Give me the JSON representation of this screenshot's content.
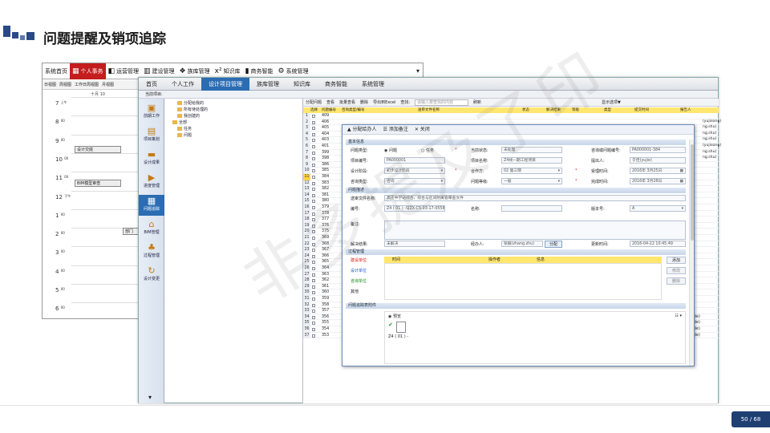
{
  "slide": {
    "title": "问题提醒及销项追踪",
    "page": "50 / 68",
    "watermark": "非多提及了印"
  },
  "back_window": {
    "tabs": [
      {
        "label": "系统首页",
        "icon": ""
      },
      {
        "label": "个人事务",
        "icon": "calendar-icon",
        "active": true
      },
      {
        "label": "运营管理",
        "icon": "chart-icon"
      },
      {
        "label": "建设管理",
        "icon": "building-icon"
      },
      {
        "label": "族库管理",
        "icon": "cubes-icon"
      },
      {
        "label": "知识库",
        "icon": "formula-icon",
        "icon_text": "x²"
      },
      {
        "label": "商务智能",
        "icon": "bar-chart-icon"
      },
      {
        "label": "系统管理",
        "icon": "gear-icon"
      }
    ],
    "calendar_views": [
      "日视图",
      "周视图",
      "工作日周视图",
      "月视图"
    ],
    "date_label": "十月 10",
    "times": [
      "7 上午",
      "8 00",
      "9 00",
      "10 00",
      "11 00",
      "12 下午",
      "1 00",
      "2 00",
      "3 00",
      "4 00",
      "5 00",
      "6 00"
    ],
    "events": [
      "设计交底",
      "BIM模型审查",
      "部门"
    ]
  },
  "front_window": {
    "nav": [
      "首页",
      "个人工作",
      "设计项目管理",
      "族库管理",
      "知识库",
      "商务智能",
      "系统管理"
    ],
    "nav_active": "设计项目管理",
    "subnav": "当前项目:",
    "sidebar": [
      "前期工作",
      "项目策划",
      "设计成果",
      "进度管理",
      "问题追踪",
      "BIM管理",
      "过程管理",
      "设计变更"
    ],
    "sidebar_active": "问题追踪",
    "tree": [
      "分配给我的",
      "所有待处理的",
      "我创建的",
      "全部",
      "任务",
      "问题"
    ],
    "toolbar": [
      "分配问题",
      "查看",
      "批量查看",
      "删除",
      "导出到Excel",
      "查找:",
      "请输入要查找的内容",
      "刷新",
      "显示选项▼"
    ],
    "grid_headers": [
      "选择",
      "问题编号",
      "咨询类型/编号",
      "送审文件名称",
      "状态",
      "解决结果",
      "等级",
      "类型",
      "提交时间",
      "报告人"
    ],
    "rows": [
      {
        "n": "1",
        "id": "409"
      },
      {
        "n": "2",
        "id": "406"
      },
      {
        "n": "3",
        "id": "405"
      },
      {
        "n": "4",
        "id": "404"
      },
      {
        "n": "5",
        "id": "403"
      },
      {
        "n": "6",
        "id": "401"
      },
      {
        "n": "7",
        "id": "399"
      },
      {
        "n": "8",
        "id": "398"
      },
      {
        "n": "9",
        "id": "386"
      },
      {
        "n": "10",
        "id": "385"
      },
      {
        "n": "11",
        "id": "384"
      },
      {
        "n": "12",
        "id": "383"
      },
      {
        "n": "13",
        "id": "382"
      },
      {
        "n": "14",
        "id": "381"
      },
      {
        "n": "15",
        "id": "380"
      },
      {
        "n": "16",
        "id": "379"
      },
      {
        "n": "17",
        "id": "378"
      },
      {
        "n": "18",
        "id": "377"
      },
      {
        "n": "19",
        "id": "376"
      },
      {
        "n": "20",
        "id": "375"
      },
      {
        "n": "21",
        "id": "369"
      },
      {
        "n": "22",
        "id": "368"
      },
      {
        "n": "23",
        "id": "367"
      },
      {
        "n": "24",
        "id": "366"
      },
      {
        "n": "25",
        "id": "365"
      },
      {
        "n": "26",
        "id": "364"
      },
      {
        "n": "27",
        "id": "363"
      },
      {
        "n": "28",
        "id": "362"
      },
      {
        "n": "29",
        "id": "361"
      },
      {
        "n": "30",
        "id": "360"
      },
      {
        "n": "31",
        "id": "359"
      },
      {
        "n": "32",
        "id": "358"
      },
      {
        "n": "33",
        "id": "357"
      },
      {
        "n": "34",
        "id": "356",
        "file": "Z4 ( 01 ) -SJZX-SS-000-FJ审字 ( 2016 ) 第011号 施工图设计四文件设计 ( 结构 )",
        "status": "未处理",
        "result": "未解决",
        "level": "一般",
        "type": "软审",
        "date": "2016-03-25",
        "reporter": "于佳(yujie)"
      },
      {
        "n": "35",
        "id": "355",
        "file": "Z4 ( 01 ) -SJZX-SS-000-JZ审字 ( 2016 ) 第010号 施工图设计四文件 ( 建筑 )",
        "status": "未处理",
        "result": "未解决",
        "level": "一般",
        "type": "软审",
        "date": "2016-03-25",
        "reporter": "于佳(yujie)"
      },
      {
        "n": "36",
        "id": "354",
        "file": "Z4 ( 01 ) -SJZX-SS-000-XC审字 ( 2016 ) 第009 施工图设计四文件 ( 行车 )",
        "status": "未处理",
        "result": "未解决",
        "level": "建议",
        "type": "软审",
        "date": "2016-03-25",
        "reporter": "于佳(yujie)"
      },
      {
        "n": "37",
        "id": "353",
        "file": "Z4 ( 01 ) -SJZX-SS-000-GD审字 ( 2016 ) 第008 施工图设计四文件 ( 轨道 )",
        "status": "未处理",
        "result": "未解决",
        "level": "建议",
        "type": "软审",
        "date": "2016-03-25",
        "reporter": "于佳(yujie)"
      }
    ],
    "selected_row": "11",
    "right_col": [
      "(yujieang)",
      "ng.shu)",
      "ng.shu)",
      "ng.shu)",
      "(yujieang)",
      "ng.shu)",
      "ng.shu)"
    ]
  },
  "dialog": {
    "toolbar": [
      "分配给办人",
      "添加备注",
      "关闭"
    ],
    "sections": [
      "基本信息",
      "问题描述",
      "过程管理",
      "问题追踪表附件"
    ],
    "fields": {
      "问题类型": "问题",
      "任务": "任务",
      "当前状态": "未处理",
      "咨询或问题编号": "PA000001-384",
      "项目编号": "PA000001",
      "项目名称": "Z4线一期工程项目",
      "提出人": "于佳(yujie)",
      "设计阶段": "初步设计阶段",
      "合作方": "02 第三院",
      "受理时间": "2016年 3月25日",
      "咨询类型": "咨询",
      "问题等级": "一般",
      "完成时间": "2016年 3月28日",
      "送审文件名称": "高庄中学站综合、综合与区间附属管审查文件",
      "编号": "Z4 ( 01 ) -SJZX-CS-03-17-0558",
      "名称": "",
      "版本号": "A",
      "备注": "",
      "解决结果": "未解决",
      "经办人": "张振(zhang.zhu)",
      "更新时间": "2016-04-22 10:45:49"
    },
    "labels": {
      "问题类型": "问题类型:",
      "当前状态": "当前状态:",
      "咨询或问题编号": "咨询或问题编号:",
      "项目编号": "项目编号:",
      "项目名称": "项目名称:",
      "提出人": "提出人:",
      "设计阶段": "设计阶段:",
      "合作方": "合作方:",
      "受理时间": "受理时间:",
      "咨询类型": "咨询类型:",
      "问题等级": "问题等级:",
      "完成时间": "完成时间:",
      "送审文件名称": "送审文件名称:",
      "编号": "编号:",
      "名称": "名称:",
      "版本号": "版本号:",
      "备注": "备注:",
      "解决结果": "解决结果:",
      "经办人": "经办人:",
      "更新时间": "更新时间:"
    },
    "dist_button": "分配",
    "org_header": [
      "时间",
      "操作者",
      "信息"
    ],
    "org_labels": [
      {
        "label": "建设单位",
        "color": "#d11"
      },
      {
        "label": "设计单位",
        "color": "#1a4fd6"
      },
      {
        "label": "咨询单位",
        "color": "#1d8a1d"
      },
      {
        "label": "其他",
        "color": "#222"
      }
    ],
    "org_buttons": [
      "添加",
      "修改",
      "删除"
    ],
    "attachment": {
      "tab": "预览",
      "item": "Z4 ( 01 ) -"
    }
  }
}
